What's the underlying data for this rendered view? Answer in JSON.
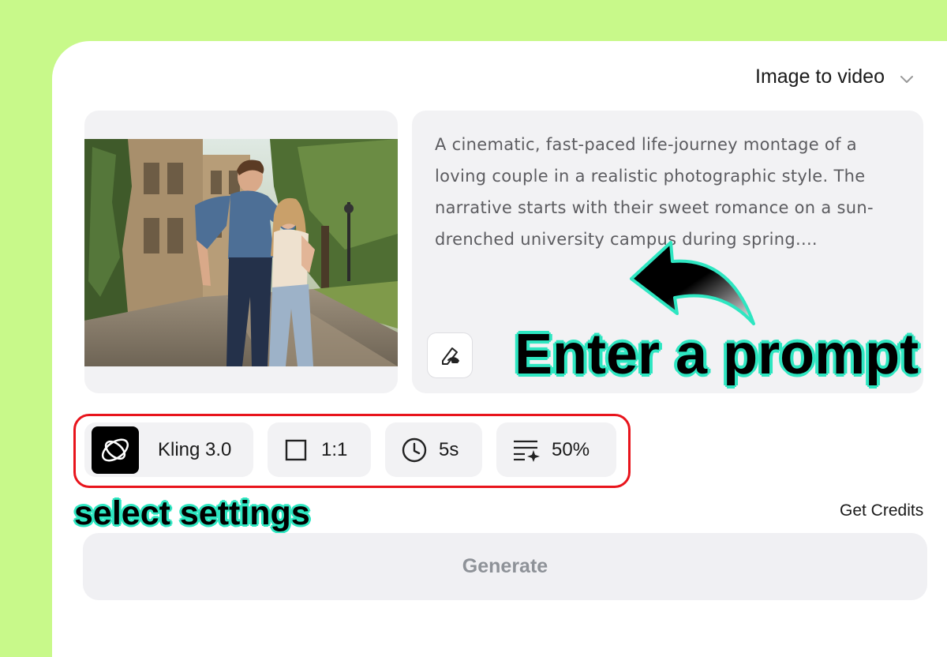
{
  "mode_selector": {
    "label": "Image to video",
    "icon": "chevron-down-icon"
  },
  "source_image": {
    "alt": "Photo of a smiling couple standing on a cobblestone university campus path"
  },
  "prompt": {
    "text": "A cinematic, fast-paced life-journey montage of a loving couple in a realistic photographic style. The narrative starts with their sweet romance on a sun-drenched university campus during spring....",
    "enhance_icon": "magic-pen-icon"
  },
  "annotations": {
    "enter_prompt": "Enter a prompt",
    "select_settings": "select settings",
    "accent_color": "#2ee6c1",
    "highlight_color": "#e8141c"
  },
  "settings": {
    "model": {
      "label": "Kling 3.0",
      "icon": "kling-logo-icon"
    },
    "aspect_ratio": {
      "label": "1:1",
      "icon": "square-icon"
    },
    "duration": {
      "label": "5s",
      "icon": "clock-icon"
    },
    "strength": {
      "label": "50%",
      "icon": "sparkle-lines-icon"
    }
  },
  "credits_link": "Get Credits",
  "generate_button": "Generate",
  "colors": {
    "background": "#c8f98a",
    "panel": "#f2f2f4"
  }
}
